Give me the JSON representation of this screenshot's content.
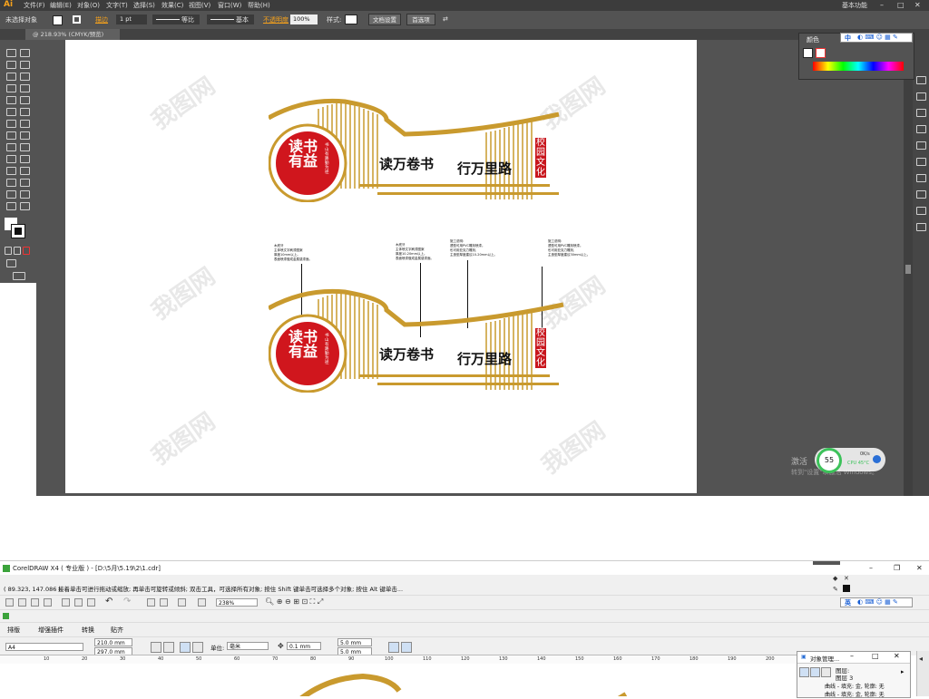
{
  "illustrator": {
    "logo": "Ai",
    "menu": [
      "文件(F)",
      "编辑(E)",
      "对象(O)",
      "文字(T)",
      "选择(S)",
      "效果(C)",
      "视图(V)",
      "窗口(W)",
      "帮助(H)"
    ],
    "workspace": "基本功能",
    "control": {
      "no_selection": "未选择对象",
      "stroke_label": "描边",
      "stroke_value": "1 pt",
      "profile1": "等比",
      "profile2": "基本",
      "opacity_label": "不透明度",
      "opacity_value": "100%",
      "style_label": "样式:",
      "doc_setup": "文档设置",
      "prefs": "首选项"
    },
    "doc_tab": "@ 218.93% (CMYK/预览)",
    "color_panel_title": "颜色",
    "ime": "中",
    "windows_watermark": {
      "line1": "激活",
      "line2": "转到\"设置\"以激活 Windows。"
    },
    "perf_widget": {
      "percent": "55",
      "net": "0K/s",
      "cpu": "CPU 45°C"
    }
  },
  "artwork": {
    "circle_title": [
      "读书",
      "有益"
    ],
    "circle_sub": [
      "书山有路勤为径"
    ],
    "main_left": "读万卷书",
    "main_right": "行万里路",
    "tag": "校园文化",
    "colors": {
      "gold": "#c99a2e",
      "red": "#d0161d",
      "ink": "#111111"
    },
    "notes": [
      "木底牙\n主体喷文字刷漆图案\n厚度10mm以上。\n表面喷漆做成金属感漆面。",
      "木底牙\n主体喷文字刷漆图案\n厚度10-20mm以上。\n表面喷漆做成金属感漆面。",
      "施工说明:\n透型可用PVC雕刻喷漆。\n也可用亚克力雕刻,\n主造型厚度建议10-20mm以上。",
      "施工说明:\n透型可用PVC雕刻喷漆。\n也可用亚克力雕刻,\n主造型厚度建议30mm以上。"
    ],
    "watermark": "我图网"
  },
  "coreldraw": {
    "title": "CorelDRAW X4 ( 专业版 ) - [D:\\5月\\5.19\\2\\1.cdr]",
    "coords": "( 89.323, 147.086 )",
    "status_text": "接着单击可进行拖动或缩放; 再单击可旋转或倾斜; 双击工具，可选择所有对象; 按住 Shift 键单击可选择多个对象; 按住 Alt 键单击...",
    "zoom": "238%",
    "ime": "英",
    "tabs": [
      "排版",
      "增强插件",
      "转换",
      "贴齐"
    ],
    "paper": "A4",
    "width": "210.0 mm",
    "height": "297.0 mm",
    "units_label": "单位:",
    "units": "毫米",
    "nudge": "0.1 mm",
    "dup_x": "5.0 mm",
    "dup_y": "5.0 mm",
    "ruler": [
      "10",
      "20",
      "30",
      "40",
      "50",
      "60",
      "70",
      "80",
      "90",
      "100",
      "110",
      "120",
      "130",
      "140",
      "150",
      "160",
      "170",
      "180",
      "190",
      "200"
    ],
    "obj_manager": {
      "title": "对象管理...",
      "layer1": "图层:",
      "layer2": "图层 3",
      "item1": "曲线 - 填充: 金, 轮廓: 无",
      "item2": "曲线 - 填充: 金, 轮廓: 无"
    }
  }
}
